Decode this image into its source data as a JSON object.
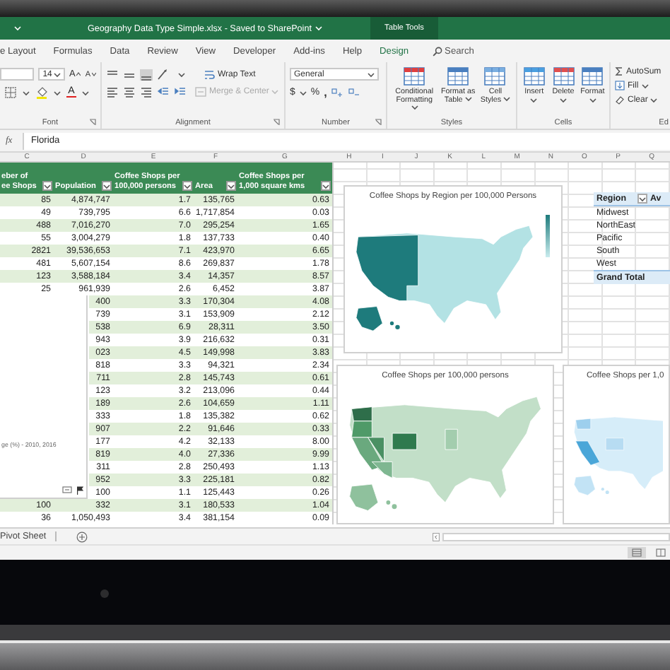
{
  "title_bar": {
    "title": "Geography Data Type Simple.xlsx  -  Saved to SharePoint",
    "context_tab": "Table Tools"
  },
  "ribbon_tabs": [
    {
      "label": "e Layout",
      "kind": "normal"
    },
    {
      "label": "Formulas",
      "kind": "normal"
    },
    {
      "label": "Data",
      "kind": "normal"
    },
    {
      "label": "Review",
      "kind": "normal"
    },
    {
      "label": "View",
      "kind": "normal"
    },
    {
      "label": "Developer",
      "kind": "normal"
    },
    {
      "label": "Add-ins",
      "kind": "normal"
    },
    {
      "label": "Help",
      "kind": "normal"
    },
    {
      "label": "Design",
      "kind": "contextual"
    }
  ],
  "tell_me": {
    "placeholder": "Search"
  },
  "font_group": {
    "label": "Font",
    "size": "14",
    "grow": "A",
    "shrink": "A",
    "font_color": "A"
  },
  "alignment_group": {
    "label": "Alignment",
    "wrap_text": "Wrap Text",
    "merge": {
      "label": "Merge & Center",
      "disabled": true
    }
  },
  "number_group": {
    "label": "Number",
    "format": "General",
    "currency": "$",
    "percent": "%",
    "comma": ","
  },
  "styles_group": {
    "label": "Styles",
    "buttons": [
      "Conditional Formatting",
      "Format as Table",
      "Cell Styles"
    ]
  },
  "cells_group": {
    "label": "Cells",
    "buttons": [
      "Insert",
      "Delete",
      "Format"
    ]
  },
  "editing_group": {
    "label": "Ed",
    "buttons": [
      "AutoSum",
      "Fill",
      "Clear"
    ]
  },
  "formula_bar": {
    "function_label": "fx",
    "value": "Florida"
  },
  "column_letters": [
    "C",
    "D",
    "E",
    "F",
    "G",
    "H",
    "I",
    "J",
    "K",
    "L",
    "M",
    "N",
    "O",
    "P",
    "Q"
  ],
  "table": {
    "columns": [
      "eber of\nee Shops",
      "Population",
      "Coffee Shops per\n100,000 persons",
      "Area",
      "Coffee Shops per\n1,000 square kms"
    ],
    "rows": [
      [
        "85",
        "4,874,747",
        "1.7",
        "135,765",
        "0.63"
      ],
      [
        "49",
        "739,795",
        "6.6",
        "1,717,854",
        "0.03"
      ],
      [
        "488",
        "7,016,270",
        "7.0",
        "295,254",
        "1.65"
      ],
      [
        "55",
        "3,004,279",
        "1.8",
        "137,733",
        "0.40"
      ],
      [
        "2821",
        "39,536,653",
        "7.1",
        "423,970",
        "6.65"
      ],
      [
        "481",
        "5,607,154",
        "8.6",
        "269,837",
        "1.78"
      ],
      [
        "123",
        "3,588,184",
        "3.4",
        "14,357",
        "8.57"
      ],
      [
        "25",
        "961,939",
        "2.6",
        "6,452",
        "3.87"
      ],
      [
        "",
        "400",
        "3.3",
        "170,304",
        "4.08"
      ],
      [
        "",
        "739",
        "3.1",
        "153,909",
        "2.12"
      ],
      [
        "",
        "538",
        "6.9",
        "28,311",
        "3.50"
      ],
      [
        "",
        "943",
        "3.9",
        "216,632",
        "0.31"
      ],
      [
        "",
        "023",
        "4.5",
        "149,998",
        "3.83"
      ],
      [
        "",
        "818",
        "3.3",
        "94,321",
        "2.34"
      ],
      [
        "",
        "711",
        "2.8",
        "145,743",
        "0.61"
      ],
      [
        "",
        "123",
        "3.2",
        "213,096",
        "0.44"
      ],
      [
        "",
        "189",
        "2.6",
        "104,659",
        "1.11"
      ],
      [
        "",
        "333",
        "1.8",
        "135,382",
        "0.62"
      ],
      [
        "",
        "907",
        "2.2",
        "91,646",
        "0.33"
      ],
      [
        "",
        "177",
        "4.2",
        "32,133",
        "8.00"
      ],
      [
        "",
        "819",
        "4.0",
        "27,336",
        "9.99"
      ],
      [
        "",
        "311",
        "2.8",
        "250,493",
        "1.13"
      ],
      [
        "",
        "952",
        "3.3",
        "225,181",
        "0.82"
      ],
      [
        "",
        "100",
        "1.1",
        "125,443",
        "0.26"
      ],
      [
        "100",
        "332",
        "3.1",
        "180,533",
        "1.04"
      ],
      [
        "36",
        "1,050,493",
        "3.4",
        "381,154",
        "0.09"
      ]
    ]
  },
  "data_card": {
    "text": "ge (%) - 2010, 2016"
  },
  "charts": [
    {
      "kind": "region",
      "title": "Coffee Shops by Region per 100,000 Persons"
    },
    {
      "kind": "green",
      "title": "Coffee Shops per 100,000 persons"
    },
    {
      "kind": "blue",
      "title": "Coffee Shops per 1,0"
    }
  ],
  "pivot": {
    "header": "Region",
    "next_header": "Av",
    "rows": [
      {
        "label": "Midwest",
        "kind": "item"
      },
      {
        "label": "NorthEast",
        "kind": "item"
      },
      {
        "label": "Pacific",
        "kind": "item"
      },
      {
        "label": "South",
        "kind": "item"
      },
      {
        "label": "West",
        "kind": "item"
      },
      {
        "label": "Grand Total",
        "kind": "total"
      }
    ]
  },
  "sheet_tabs": [
    {
      "label": "Pivot Sheet"
    }
  ]
}
